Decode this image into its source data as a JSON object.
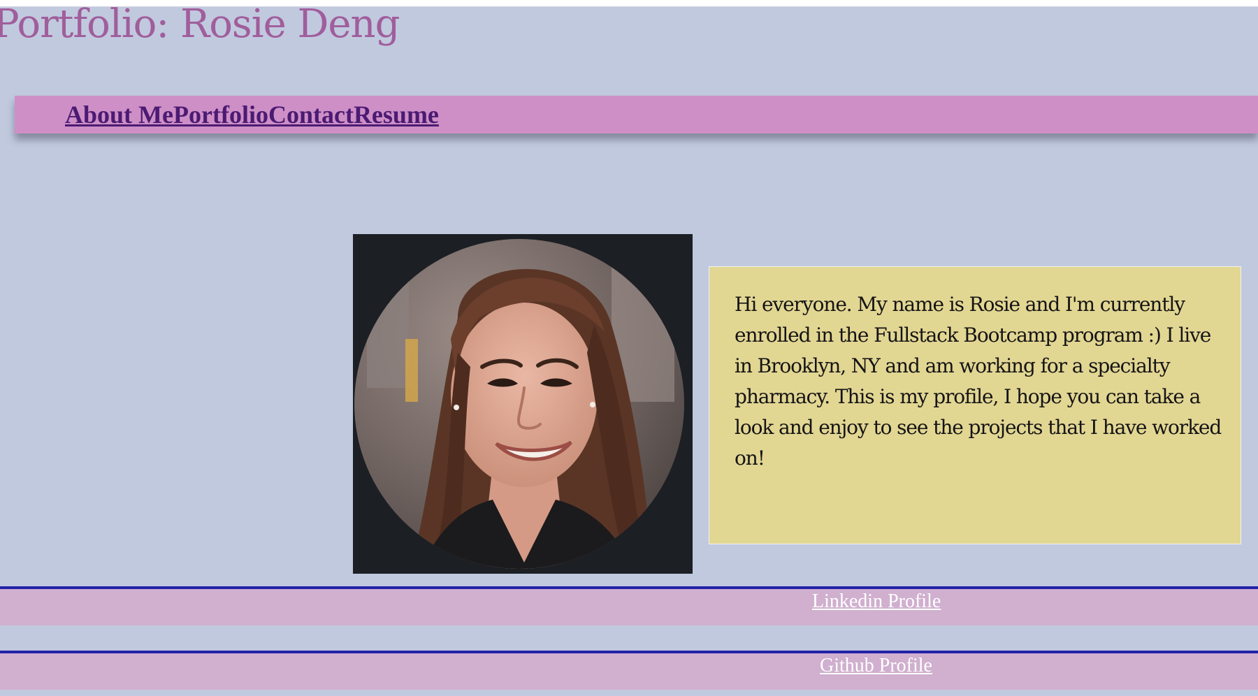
{
  "header": {
    "title": "Portfolio: Rosie Deng"
  },
  "nav": {
    "items": [
      {
        "label": "About Me"
      },
      {
        "label": "Portfolio"
      },
      {
        "label": "Contact"
      },
      {
        "label": "Resume"
      }
    ]
  },
  "about": {
    "photo_subject": "profile-photo",
    "bio": "Hi everyone. My name is Rosie and I'm currently enrolled in the Fullstack Bootcamp program :) I live in Brooklyn, NY and am working for a specialty pharmacy. This is my profile, I hope you can take a look and enjoy to see the projects that I have worked on!"
  },
  "footer": {
    "linkedin_label": "Linkedin Profile",
    "github_label": "Github Profile"
  },
  "colors": {
    "page_background": "#c1c9df",
    "title": "#a05e9b",
    "navbar": "#ce8fc6",
    "nav_link": "#4b1a73",
    "bio_box": "#e2d693",
    "footer_bar": "#d0afcf",
    "footer_border": "#2222a6",
    "footer_link": "#ffffff"
  }
}
